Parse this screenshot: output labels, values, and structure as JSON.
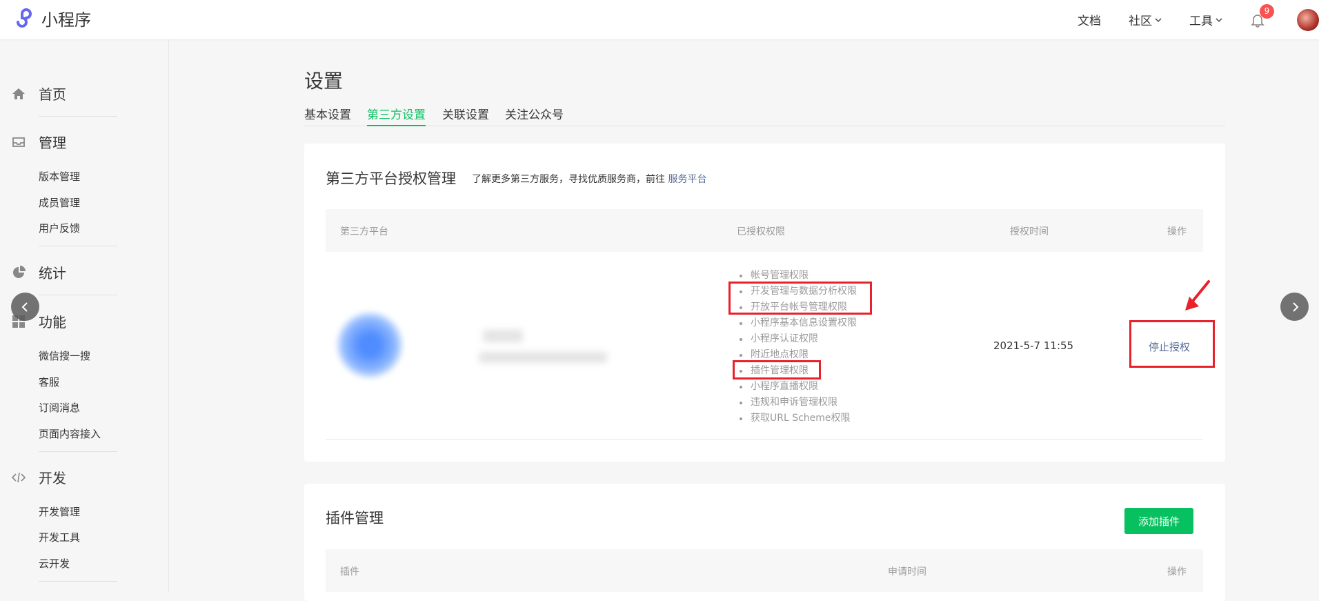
{
  "header": {
    "app_name": "小程序",
    "nav": {
      "docs": "文档",
      "community": "社区",
      "tools": "工具"
    },
    "notification_count": "9"
  },
  "sidebar": {
    "groups": [
      {
        "label": "首页",
        "icon": "home-icon"
      },
      {
        "label": "管理",
        "icon": "inbox-icon",
        "items": [
          "版本管理",
          "成员管理",
          "用户反馈"
        ]
      },
      {
        "label": "统计",
        "icon": "pie-chart-icon"
      },
      {
        "label": "功能",
        "icon": "grid-icon",
        "items": [
          "微信搜一搜",
          "客服",
          "订阅消息",
          "页面内容接入"
        ]
      },
      {
        "label": "开发",
        "icon": "code-icon",
        "items": [
          "开发管理",
          "开发工具",
          "云开发"
        ]
      }
    ]
  },
  "page": {
    "title": "设置",
    "tabs": [
      "基本设置",
      "第三方设置",
      "关联设置",
      "关注公众号"
    ],
    "active_tab": 1
  },
  "third_party": {
    "title": "第三方平台授权管理",
    "desc_prefix": "了解更多第三方服务，寻找优质服务商，前往",
    "desc_link": "服务平台",
    "columns": [
      "第三方平台",
      "已授权权限",
      "授权时间",
      "操作"
    ],
    "row": {
      "permissions": [
        "帐号管理权限",
        "开发管理与数据分析权限",
        "开放平台帐号管理权限",
        "小程序基本信息设置权限",
        "小程序认证权限",
        "附近地点权限",
        "插件管理权限",
        "小程序直播权限",
        "违规和申诉管理权限",
        "获取URL Scheme权限"
      ],
      "time": "2021-5-7 11:55",
      "action": "停止授权"
    }
  },
  "plugins": {
    "title": "插件管理",
    "add_button": "添加插件",
    "columns": [
      "插件",
      "申请时间",
      "操作"
    ]
  },
  "colors": {
    "accent": "#07c160",
    "link": "#576b95",
    "highlight": "#e8212a"
  }
}
